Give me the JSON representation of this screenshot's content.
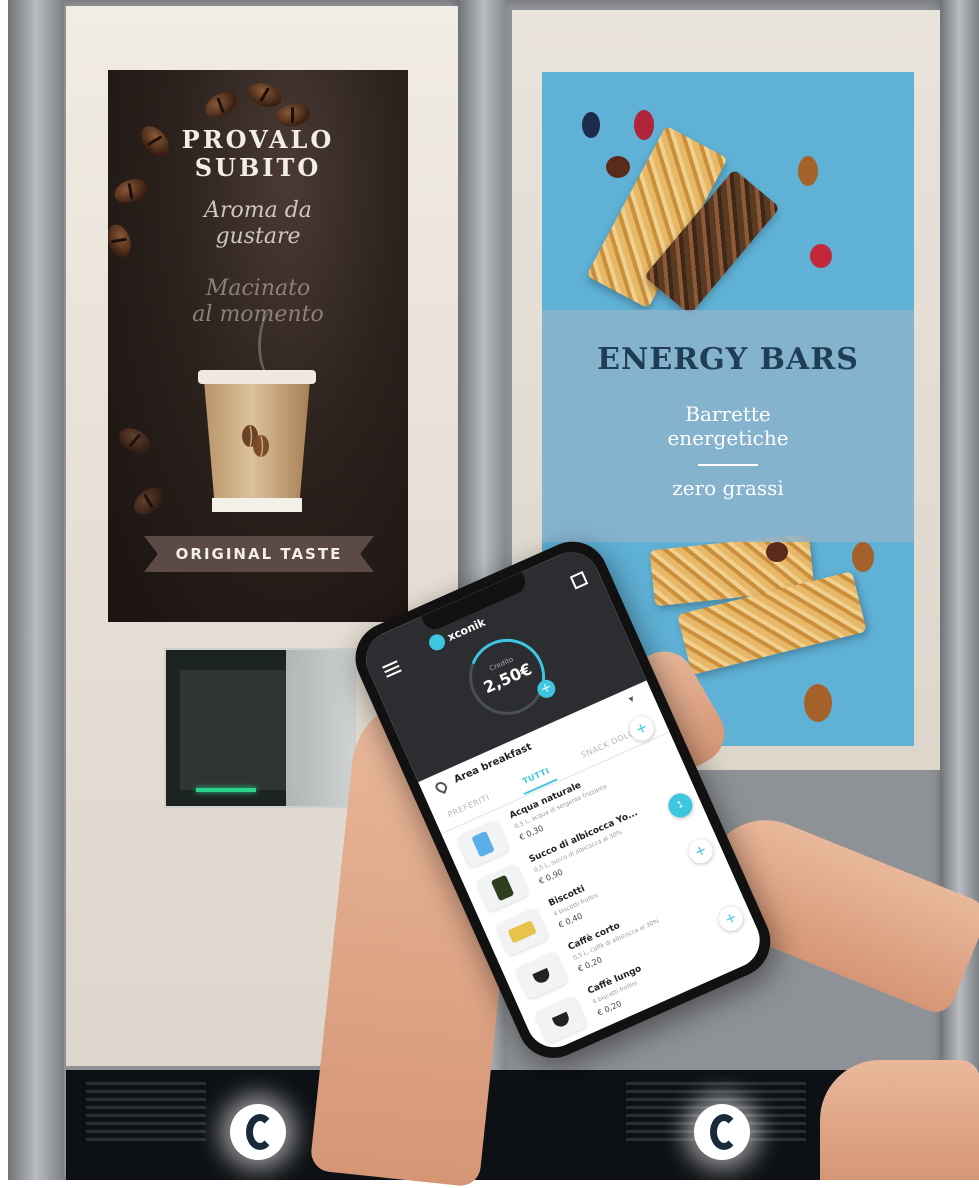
{
  "left_screen": {
    "headline": [
      "PROVALO",
      "SUBITO"
    ],
    "tagline_1": [
      "Aroma da",
      "gustare"
    ],
    "tagline_2": [
      "Macinato",
      "al momento"
    ],
    "ribbon": "ORIGINAL TASTE"
  },
  "right_screen": {
    "title": "ENERGY BARS",
    "subtitle": [
      "Barrette",
      "energetiche"
    ],
    "claim": "zero grassi",
    "colors": {
      "background": "#5fb1d6",
      "title": "#1f3d55"
    }
  },
  "phone_app": {
    "brand": "xconik",
    "balance_label": "Credito",
    "balance": "2,50€",
    "location": "Area breakfast",
    "tabs": [
      "PREFERITI",
      "TUTTI",
      "SNACK DOLCI"
    ],
    "active_tab": "TUTTI",
    "products": [
      {
        "name": "Acqua naturale",
        "desc": "0,5 L, acqua di sorgente frizzante",
        "price": "€ 0,30",
        "action": "+",
        "icon": "water-bottle-icon"
      },
      {
        "name": "Succo di albicocca Yo...",
        "desc": "0,5 L, succo di albicocca al 30%",
        "price": "€ 0,90",
        "action": "1",
        "icon": "juice-bottle-icon"
      },
      {
        "name": "Biscotti",
        "desc": "4 biscotti frollini",
        "price": "€ 0,40",
        "action": "+",
        "icon": "biscuit-pack-icon"
      },
      {
        "name": "Caffè corto",
        "desc": "0,5 L, caffè di albicocca al 30%",
        "price": "€ 0,20",
        "action": "+",
        "icon": "coffee-cup-icon"
      },
      {
        "name": "Caffè lungo",
        "desc": "4 biscotti frollini",
        "price": "€ 0,20",
        "action": "+",
        "icon": "coffee-cup-icon"
      }
    ],
    "accent_color": "#3ec6e0"
  }
}
